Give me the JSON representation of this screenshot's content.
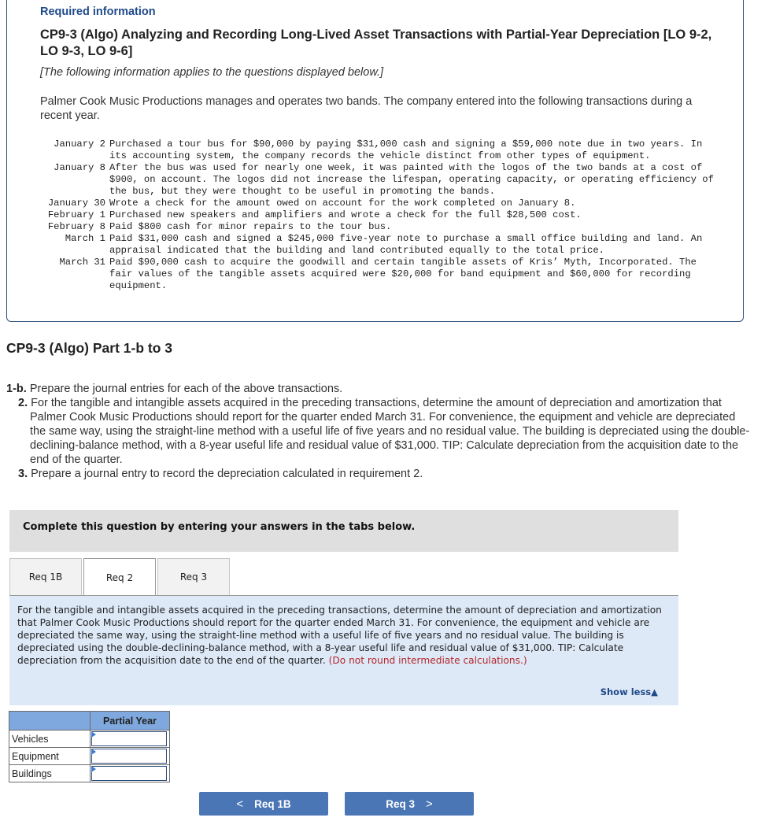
{
  "info": {
    "required_label": "Required information",
    "title": "CP9-3 (Algo) Analyzing and Recording Long-Lived Asset Transactions with Partial-Year Depreciation [LO 9-2, LO 9-3, LO 9-6]",
    "applies_note": "[The following information applies to the questions displayed below.]",
    "intro": "Palmer Cook Music Productions manages and operates two bands. The company entered into the following transactions during a recent year.",
    "transactions": [
      {
        "date": "January 2",
        "description": "Purchased a tour bus for $90,000 by paying $31,000 cash and signing a $59,000 note due in two years. In its accounting system, the company records the vehicle distinct from other types of equipment."
      },
      {
        "date": "January 8",
        "description": "After the bus was used for nearly one week, it was painted with the logos of the two bands at a cost of $900, on account. The logos did not increase the lifespan, operating capacity, or operating efficiency of the bus, but they were thought to be useful in promoting the bands."
      },
      {
        "date": "January 30",
        "description": "Wrote a check for the amount owed on account for the work completed on January 8."
      },
      {
        "date": "February 1",
        "description": "Purchased new speakers and amplifiers and wrote a check for the full $28,500 cost."
      },
      {
        "date": "February 8",
        "description": "Paid $800 cash for minor repairs to the tour bus."
      },
      {
        "date": "March 1",
        "description": "Paid $31,000 cash and signed a $245,000 five-year note to purchase a small office building and land. An appraisal indicated that the building and land contributed equally to the total price."
      },
      {
        "date": "March 31",
        "description": "Paid $90,000 cash to acquire the goodwill and certain tangible assets of Kris’ Myth, Incorporated. The fair values of the tangible assets acquired were $20,000 for band equipment and $60,000 for recording equipment."
      }
    ]
  },
  "part": {
    "title": "CP9-3 (Algo) Part 1-b to 3",
    "requirements": [
      {
        "num": "1-b.",
        "text": "Prepare the journal entries for each of the above transactions."
      },
      {
        "num": "2.",
        "text": "For the tangible and intangible assets acquired in the preceding transactions, determine the amount of depreciation and amortization that Palmer Cook Music Productions should report for the quarter ended March 31. For convenience, the equipment and vehicle are depreciated the same way, using the straight-line method with a useful life of five years and no residual value. The building is depreciated using the double-declining-balance method, with a 8-year useful life and residual value of $31,000. TIP: Calculate depreciation from the acquisition date to the end of the quarter."
      },
      {
        "num": "3.",
        "text": "Prepare a journal entry to record the depreciation calculated in requirement 2."
      }
    ]
  },
  "question": {
    "instruction": "Complete this question by entering your answers in the tabs below.",
    "tabs": [
      {
        "label": "Req 1B",
        "active": false
      },
      {
        "label": "Req 2",
        "active": true
      },
      {
        "label": "Req 3",
        "active": false
      }
    ],
    "prompt": "For the tangible and intangible assets acquired in the preceding transactions, determine the amount of depreciation and amortization that Palmer Cook Music Productions should report for the quarter ended March 31. For convenience, the equipment and vehicle are depreciated the same way, using the straight-line method with a useful life of five years and no residual value. The building is depreciated using the double-declining-balance method, with a 8-year useful life and residual value of $31,000. TIP: Calculate depreciation from the acquisition date to the end of the quarter.",
    "prompt_note": "(Do not round intermediate calculations.)",
    "show_less": "Show less",
    "show_less_icon": "triangle-up-icon"
  },
  "table": {
    "column_header": "Partial Year",
    "rows": [
      {
        "label": "Vehicles",
        "value": ""
      },
      {
        "label": "Equipment",
        "value": ""
      },
      {
        "label": "Buildings",
        "value": ""
      }
    ]
  },
  "nav": {
    "prev_label": "Req 1B",
    "next_label": "Req 3",
    "prev_icon": "chevron-left-icon",
    "next_icon": "chevron-right-icon"
  },
  "colors": {
    "accent_blue": "#4a76b5",
    "link_blue": "#1f4a8a",
    "note_red": "#b3272b",
    "panel_blue": "#dde9f7",
    "header_blue": "#7fa8de"
  }
}
